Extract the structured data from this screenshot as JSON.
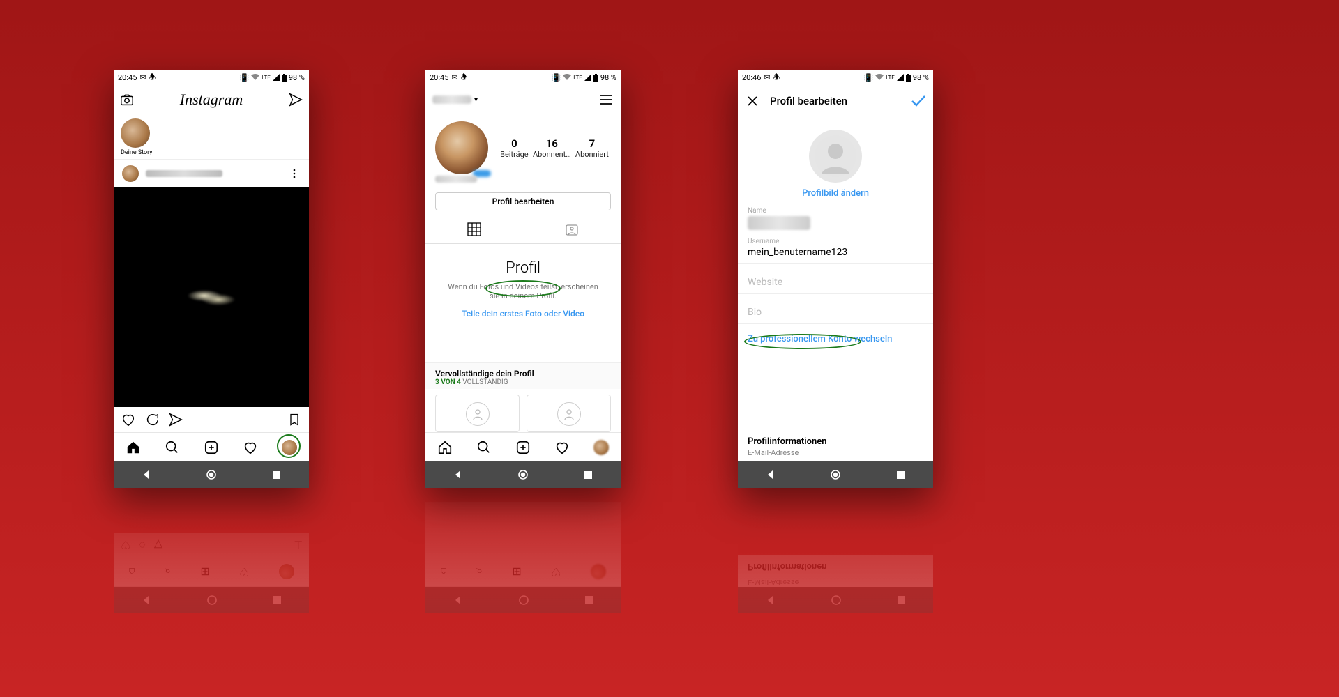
{
  "status": {
    "time_a": "20:45",
    "time_b": "20:46",
    "net_label": "LTE",
    "battery": "98 %"
  },
  "phone1": {
    "logo": "Instagram",
    "story_label": "Deine Story"
  },
  "phone2": {
    "stats": {
      "posts_n": "0",
      "posts_l": "Beiträge",
      "followers_n": "16",
      "followers_l": "Abonnent…",
      "following_n": "7",
      "following_l": "Abonniert"
    },
    "edit_btn": "Profil bearbeiten",
    "empty": {
      "title": "Profil",
      "desc": "Wenn du Fotos und Videos teilst, erscheinen sie in deinem Profil.",
      "link": "Teile dein erstes Foto oder Video"
    },
    "complete": {
      "title": "Vervollständige dein Profil",
      "sub_a": "3 VON 4",
      "sub_b": " VOLLSTÄNDIG"
    }
  },
  "phone3": {
    "title": "Profil bearbeiten",
    "change_photo": "Profilbild ändern",
    "fields": {
      "name_l": "Name",
      "username_l": "Username",
      "username_v": "mein_benutername123",
      "website_l": "Website",
      "bio_l": "Bio"
    },
    "switch_pro": "Zu professionellem Konto wechseln",
    "info_title": "Profilinformationen",
    "info_sub": "E-Mail-Adresse"
  }
}
